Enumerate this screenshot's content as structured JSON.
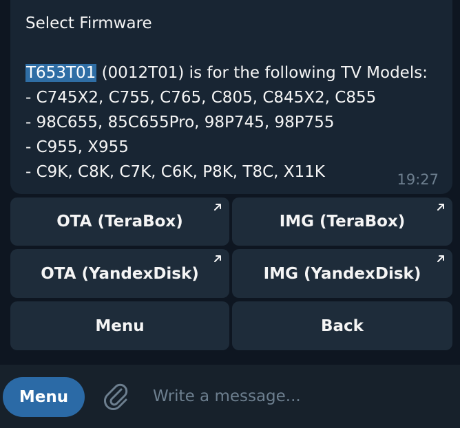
{
  "message": {
    "title": "Select Firmware",
    "firmware_id": "T653T01",
    "firmware_desc": " (0012T01) is for the following TV Models:",
    "model_lines": [
      "- C745X2, C755, C765, C805, C845X2, C855",
      "- 98C655, 85C655Pro, 98P745, 98P755",
      "- C955, X955",
      "- C9K, C8K, C7K, C6K, P8K, T8C, X11K"
    ],
    "time": "19:27"
  },
  "keyboard": {
    "ota_terabox": "OTA (TeraBox)",
    "img_terabox": "IMG (TeraBox)",
    "ota_yandex": "OTA (YandexDisk)",
    "img_yandex": "IMG (YandexDisk)",
    "menu": "Menu",
    "back": "Back"
  },
  "composer": {
    "menu_label": "Menu",
    "placeholder": "Write a message..."
  },
  "icons": {
    "link_arrow": "arrow-up-right-icon",
    "attach": "paperclip-icon"
  },
  "colors": {
    "background": "#0e1621",
    "bubble": "#182533",
    "button": "#1e2c3a",
    "accent": "#2b6aa6",
    "highlight": "#2f6ea5"
  }
}
